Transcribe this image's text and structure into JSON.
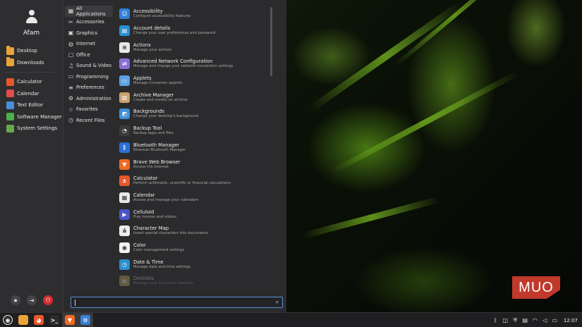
{
  "user": {
    "name": "Afam"
  },
  "sidebar": {
    "places": [
      {
        "label": "Desktop",
        "icon": "folder-icon"
      },
      {
        "label": "Downloads",
        "icon": "folder-icon"
      }
    ],
    "favorites": [
      {
        "label": "Calculator",
        "icon": "calculator-icon",
        "color": "#e8572a"
      },
      {
        "label": "Calendar",
        "icon": "calendar-icon",
        "color": "#e14c4c"
      },
      {
        "label": "Text Editor",
        "icon": "text-editor-icon",
        "color": "#4a90d9"
      },
      {
        "label": "Software Manager",
        "icon": "software-manager-icon",
        "color": "#4cae4c"
      },
      {
        "label": "System Settings",
        "icon": "system-settings-icon",
        "color": "#6aa84f"
      }
    ]
  },
  "categories": [
    {
      "label": "All Applications",
      "icon": "grid-icon",
      "glyph": "▦"
    },
    {
      "label": "Accessories",
      "icon": "accessories-icon",
      "glyph": "✂"
    },
    {
      "label": "Graphics",
      "icon": "graphics-icon",
      "glyph": "▣"
    },
    {
      "label": "Internet",
      "icon": "globe-icon",
      "glyph": "◍"
    },
    {
      "label": "Office",
      "icon": "office-icon",
      "glyph": "▢"
    },
    {
      "label": "Sound & Video",
      "icon": "sound-video-icon",
      "glyph": "♫"
    },
    {
      "label": "Programming",
      "icon": "programming-icon",
      "glyph": "▭"
    },
    {
      "label": "Preferences",
      "icon": "preferences-icon",
      "glyph": "≡"
    },
    {
      "label": "Administration",
      "icon": "administration-icon",
      "glyph": "⚙"
    },
    {
      "label": "Favorites",
      "icon": "star-icon",
      "glyph": "☆"
    },
    {
      "label": "Recent Files",
      "icon": "clock-icon",
      "glyph": "◷"
    }
  ],
  "apps": [
    {
      "name": "Accessibility",
      "desc": "Configure accessibility features",
      "icon": "accessibility-icon",
      "color": "#2f7fd6",
      "glyph": "☺"
    },
    {
      "name": "Account details",
      "desc": "Change your user preferences and password",
      "icon": "account-icon",
      "color": "#2a8fd0",
      "glyph": "▤"
    },
    {
      "name": "Actions",
      "desc": "Manage your actions",
      "icon": "actions-icon",
      "color": "#e8e8e8",
      "glyph": "≡"
    },
    {
      "name": "Advanced Network Configuration",
      "desc": "Manage and change your network connection settings",
      "icon": "network-icon",
      "color": "#8a6fd6",
      "glyph": "⇄"
    },
    {
      "name": "Applets",
      "desc": "Manage Cinnamon applets",
      "icon": "applets-icon",
      "color": "#5aa0e6",
      "glyph": "▭"
    },
    {
      "name": "Archive Manager",
      "desc": "Create and modify an archive",
      "icon": "archive-icon",
      "color": "#c9a26b",
      "glyph": "▥"
    },
    {
      "name": "Backgrounds",
      "desc": "Change your desktop's background",
      "icon": "backgrounds-icon",
      "color": "#3d8fd8",
      "glyph": "◩"
    },
    {
      "name": "Backup Tool",
      "desc": "Backup apps and files",
      "icon": "backup-icon",
      "color": "#3a3a3a",
      "glyph": "◔"
    },
    {
      "name": "Bluetooth Manager",
      "desc": "Blueman Bluetooth Manager",
      "icon": "bluetooth-icon",
      "color": "#2a6fd6",
      "glyph": "ᛒ"
    },
    {
      "name": "Brave Web Browser",
      "desc": "Access the Internet",
      "icon": "brave-icon",
      "color": "#f06a21",
      "glyph": "▼"
    },
    {
      "name": "Calculator",
      "desc": "Perform arithmetic, scientific or financial calculations",
      "icon": "calculator-icon",
      "color": "#e8572a",
      "glyph": "±"
    },
    {
      "name": "Calendar",
      "desc": "Access and manage your calendars",
      "icon": "calendar-icon",
      "color": "#e8e8e8",
      "glyph": "▦"
    },
    {
      "name": "Celluloid",
      "desc": "Play movies and videos",
      "icon": "celluloid-icon",
      "color": "#4a55c8",
      "glyph": "▶"
    },
    {
      "name": "Character Map",
      "desc": "Insert special characters into documents",
      "icon": "character-map-icon",
      "color": "#ececec",
      "glyph": "á"
    },
    {
      "name": "Color",
      "desc": "Color management settings",
      "icon": "color-icon",
      "color": "#f2f2f2",
      "glyph": "◉"
    },
    {
      "name": "Date & Time",
      "desc": "Manage date and time settings",
      "icon": "date-time-icon",
      "color": "#2a8fd0",
      "glyph": "◷"
    },
    {
      "name": "Desklets",
      "desc": "Manage your Cinnamon desklets",
      "icon": "desklets-icon",
      "color": "#c8b05a",
      "glyph": "▣"
    }
  ],
  "search": {
    "value": "",
    "placeholder": ""
  },
  "taskbar": {
    "clock": "12:07",
    "launchers": [
      {
        "name": "menu-button",
        "icon": "mint-logo-icon",
        "color": "#2e2e30",
        "glyph": "◉"
      },
      {
        "name": "files-launcher",
        "icon": "folder-icon",
        "color": "#e8a43a",
        "glyph": ""
      },
      {
        "name": "firefox-launcher",
        "icon": "firefox-icon",
        "color": "#e8572a",
        "glyph": "◕"
      },
      {
        "name": "terminal-launcher",
        "icon": "terminal-icon",
        "color": "#2a2a2a",
        "glyph": ">_"
      },
      {
        "name": "brave-launcher",
        "icon": "brave-icon",
        "color": "#f06a21",
        "glyph": "▼"
      },
      {
        "name": "settings-launcher",
        "icon": "gear-icon",
        "color": "#3a7fd6",
        "glyph": "⚙"
      }
    ]
  },
  "watermark": "MUO",
  "colors": {
    "accent": "#5a8fd6",
    "power": "#d42b2b",
    "wallpaper_green": "#8fdc2a"
  }
}
